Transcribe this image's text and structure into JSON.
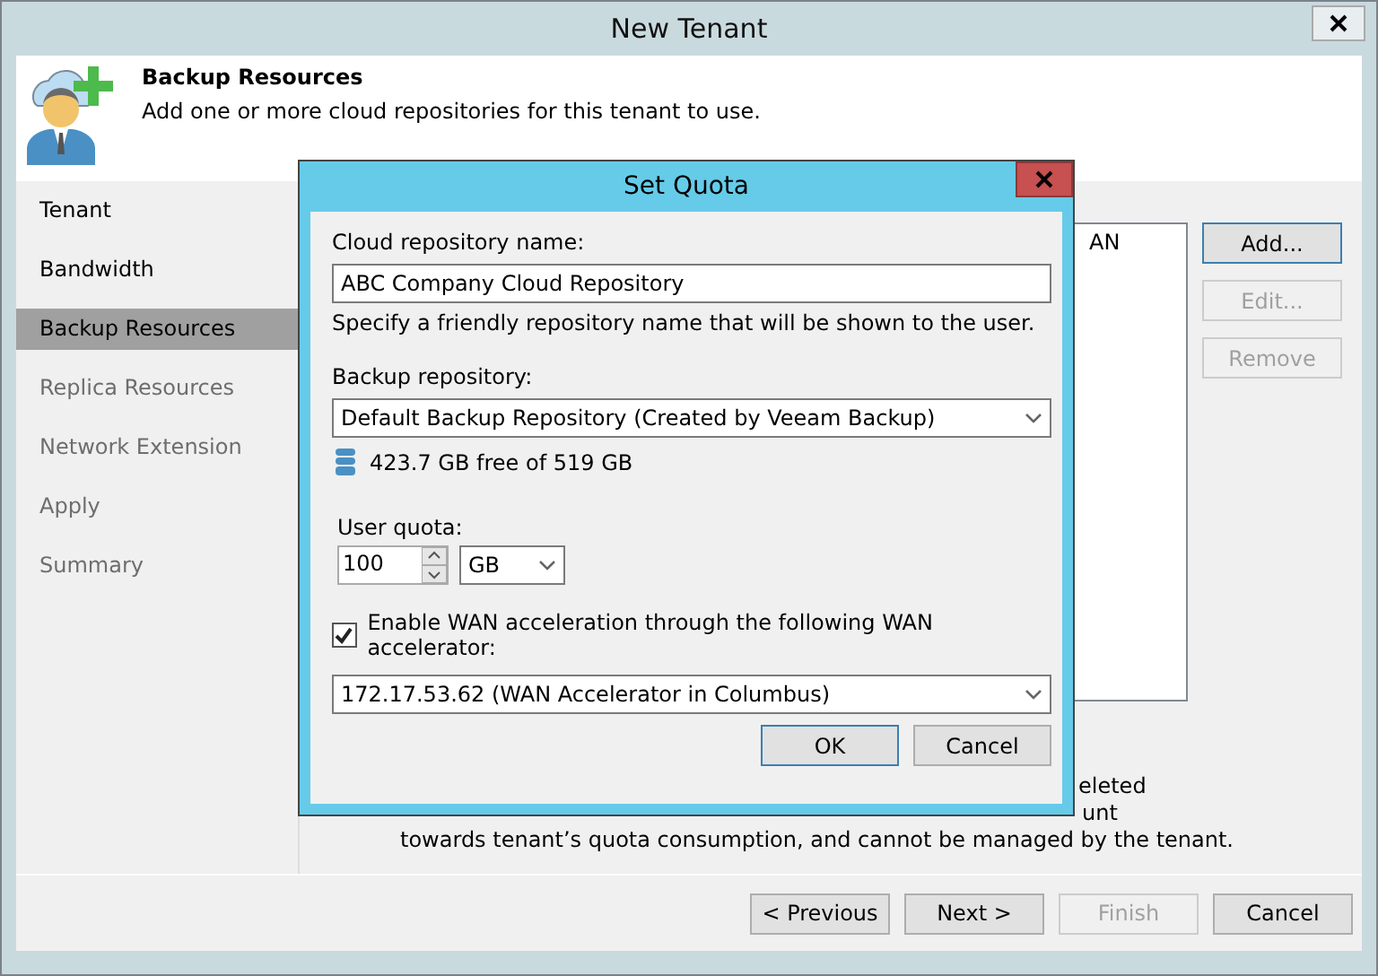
{
  "window": {
    "title": "New Tenant"
  },
  "header": {
    "title": "Backup Resources",
    "description": "Add one or more cloud repositories for this tenant to use."
  },
  "steps": [
    {
      "label": "Tenant",
      "selected": false,
      "disabled": false
    },
    {
      "label": "Bandwidth",
      "selected": false,
      "disabled": false
    },
    {
      "label": "Backup Resources",
      "selected": true,
      "disabled": false
    },
    {
      "label": "Replica Resources",
      "selected": false,
      "disabled": true
    },
    {
      "label": "Network Extension",
      "selected": false,
      "disabled": true
    },
    {
      "label": "Apply",
      "selected": false,
      "disabled": true
    },
    {
      "label": "Summary",
      "selected": false,
      "disabled": true
    }
  ],
  "repository_list": {
    "column_header": "AN"
  },
  "side_buttons": [
    {
      "label": "Add...",
      "disabled": false,
      "default": true
    },
    {
      "label": "Edit...",
      "disabled": true,
      "default": false
    },
    {
      "label": "Remove",
      "disabled": true,
      "default": false
    }
  ],
  "description_lines": [
    "eleted",
    "unt",
    "towards tenant’s quota consumption, and cannot be managed by the tenant."
  ],
  "footer_buttons": [
    {
      "label": "< Previous",
      "disabled": false
    },
    {
      "label": "Next >",
      "disabled": false
    },
    {
      "label": "Finish",
      "disabled": true
    },
    {
      "label": "Cancel",
      "disabled": false
    }
  ],
  "dialog": {
    "title": "Set Quota",
    "name_label": "Cloud repository name:",
    "name_value": "ABC Company Cloud Repository",
    "name_hint": "Specify a friendly repository name that will be shown to the user.",
    "repository_label": "Backup repository:",
    "repository_value": "Default Backup Repository (Created by Veeam Backup)",
    "free_space": "423.7 GB free of 519 GB",
    "quota_label": "User quota:",
    "quota_value": "100",
    "quota_unit": "GB",
    "wan_checkbox": {
      "label": "Enable WAN acceleration through the following WAN accelerator:",
      "checked": true
    },
    "wan_accelerator": "172.17.53.62 (WAN Accelerator in Columbus)",
    "buttons": [
      {
        "label": "OK",
        "default": true
      },
      {
        "label": "Cancel",
        "default": false
      }
    ]
  }
}
